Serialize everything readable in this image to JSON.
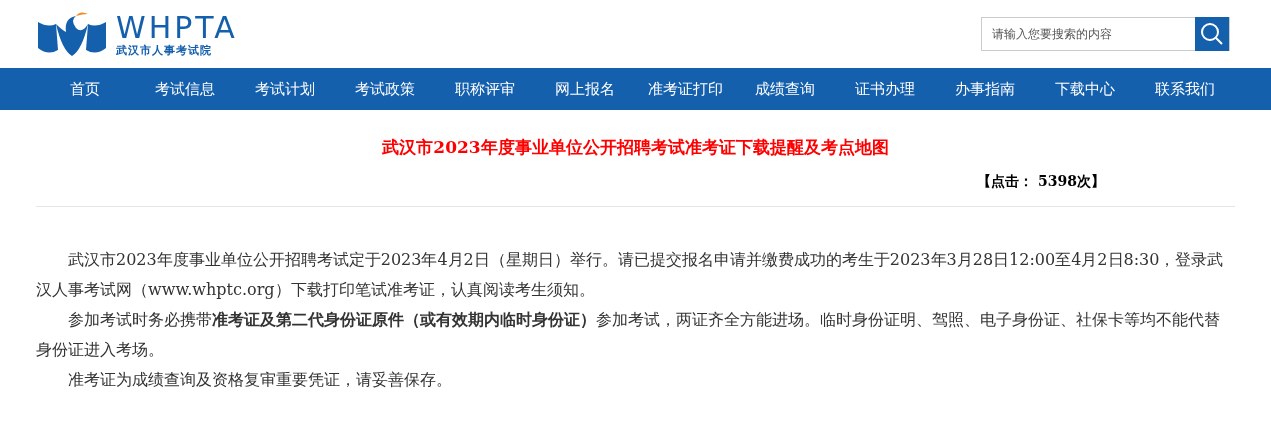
{
  "logo": {
    "wordmark": "WHPTA",
    "subtitle": "武汉市人事考试院"
  },
  "search": {
    "placeholder": "请输入您要搜索的内容"
  },
  "nav": [
    {
      "label": "首页"
    },
    {
      "label": "考试信息"
    },
    {
      "label": "考试计划"
    },
    {
      "label": "考试政策"
    },
    {
      "label": "职称评审"
    },
    {
      "label": "网上报名"
    },
    {
      "label": "准考证打印"
    },
    {
      "label": "成绩查询"
    },
    {
      "label": "证书办理"
    },
    {
      "label": "办事指南"
    },
    {
      "label": "下载中心"
    },
    {
      "label": "联系我们"
    }
  ],
  "article": {
    "title": "武汉市2023年度事业单位公开招聘考试准考证下载提醒及考点地图",
    "hits": "【点击： 5398次】",
    "paragraphs": [
      "武汉市2023年度事业单位公开招聘考试定于2023年4月2日（星期日）举行。请已提交报名申请并缴费成功的考生于2023年3月28日12:00至4月2日8:30，登录武汉人事考试网（www.whptc.org）下载打印笔试准考证，认真阅读考生须知。",
      "参加考试时务必携带**准考证及第二代身份证原件（或有效期内临时身份证）**参加考试，两证齐全方能进场。临时身份证明、驾照、电子身份证、社保卡等均不能代替身份证进入考场。",
      "准考证为成绩查询及资格复审重要凭证，请妥善保存。"
    ]
  }
}
